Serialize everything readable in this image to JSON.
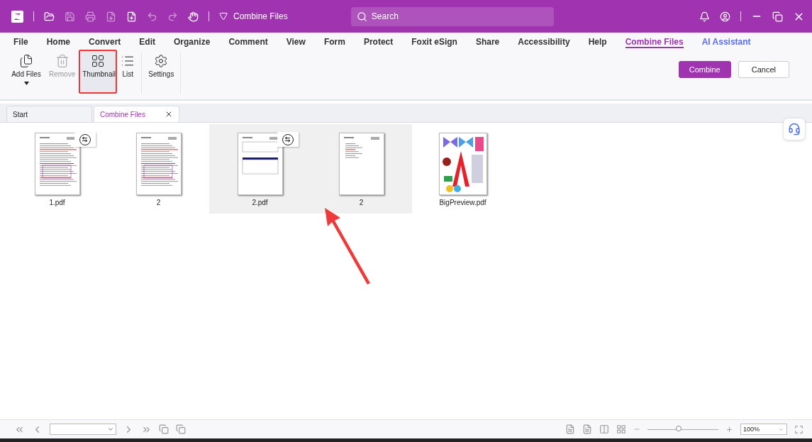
{
  "title_bar": {
    "document_title": "Combine Files",
    "search": {
      "placeholder": "Search"
    }
  },
  "menu": [
    {
      "label": "File",
      "selected": false,
      "kind": "plain"
    },
    {
      "label": "Home",
      "selected": false,
      "kind": "plain"
    },
    {
      "label": "Convert",
      "selected": false,
      "kind": "plain"
    },
    {
      "label": "Edit",
      "selected": false,
      "kind": "plain"
    },
    {
      "label": "Organize",
      "selected": false,
      "kind": "plain"
    },
    {
      "label": "Comment",
      "selected": false,
      "kind": "plain"
    },
    {
      "label": "View",
      "selected": false,
      "kind": "plain"
    },
    {
      "label": "Form",
      "selected": false,
      "kind": "plain"
    },
    {
      "label": "Protect",
      "selected": false,
      "kind": "plain"
    },
    {
      "label": "Foxit eSign",
      "selected": false,
      "kind": "plain"
    },
    {
      "label": "Share",
      "selected": false,
      "kind": "plain"
    },
    {
      "label": "Accessibility",
      "selected": false,
      "kind": "plain"
    },
    {
      "label": "Help",
      "selected": false,
      "kind": "plain"
    },
    {
      "label": "Combine Files",
      "selected": true,
      "kind": "plain"
    },
    {
      "label": "AI Assistant",
      "selected": false,
      "kind": "ai"
    }
  ],
  "ribbon": {
    "tools": [
      {
        "label": "Add Files",
        "kind": "add",
        "disabled": false,
        "selected": false,
        "highlighted": false,
        "dropdown": true
      },
      {
        "label": "Remove",
        "kind": "remove",
        "disabled": true,
        "selected": false,
        "highlighted": false,
        "dropdown": false
      },
      {
        "label": "Thumbnail",
        "kind": "thumbnail",
        "disabled": false,
        "selected": true,
        "highlighted": true,
        "dropdown": false
      },
      {
        "label": "List",
        "kind": "list",
        "disabled": false,
        "selected": false,
        "highlighted": false,
        "dropdown": false
      },
      {
        "label": "Settings",
        "kind": "settings",
        "disabled": false,
        "selected": false,
        "highlighted": false,
        "dropdown": false
      }
    ],
    "buttons": [
      {
        "label": "Combine",
        "kind": "primary"
      },
      {
        "label": "Cancel",
        "kind": "secondary"
      }
    ]
  },
  "tabs": [
    {
      "label": "Start",
      "selected": false,
      "closable": false
    },
    {
      "label": "Combine Files",
      "selected": true,
      "closable": true
    }
  ],
  "files": [
    {
      "selected": false,
      "pages": [
        {
          "label": "1.pdf",
          "kind": "text",
          "expand": true
        },
        {
          "label": "2",
          "kind": "text",
          "expand": false
        }
      ]
    },
    {
      "selected": true,
      "pages": [
        {
          "label": "2.pdf",
          "kind": "table",
          "expand": true
        },
        {
          "label": "2",
          "kind": "sparse",
          "expand": false
        }
      ]
    },
    {
      "selected": false,
      "pages": [
        {
          "label": "BigPreview.pdf",
          "kind": "image",
          "expand": false
        }
      ]
    }
  ],
  "status_bar": {
    "zoom": "100%",
    "zoom_slider": {
      "level": 0.45
    }
  }
}
